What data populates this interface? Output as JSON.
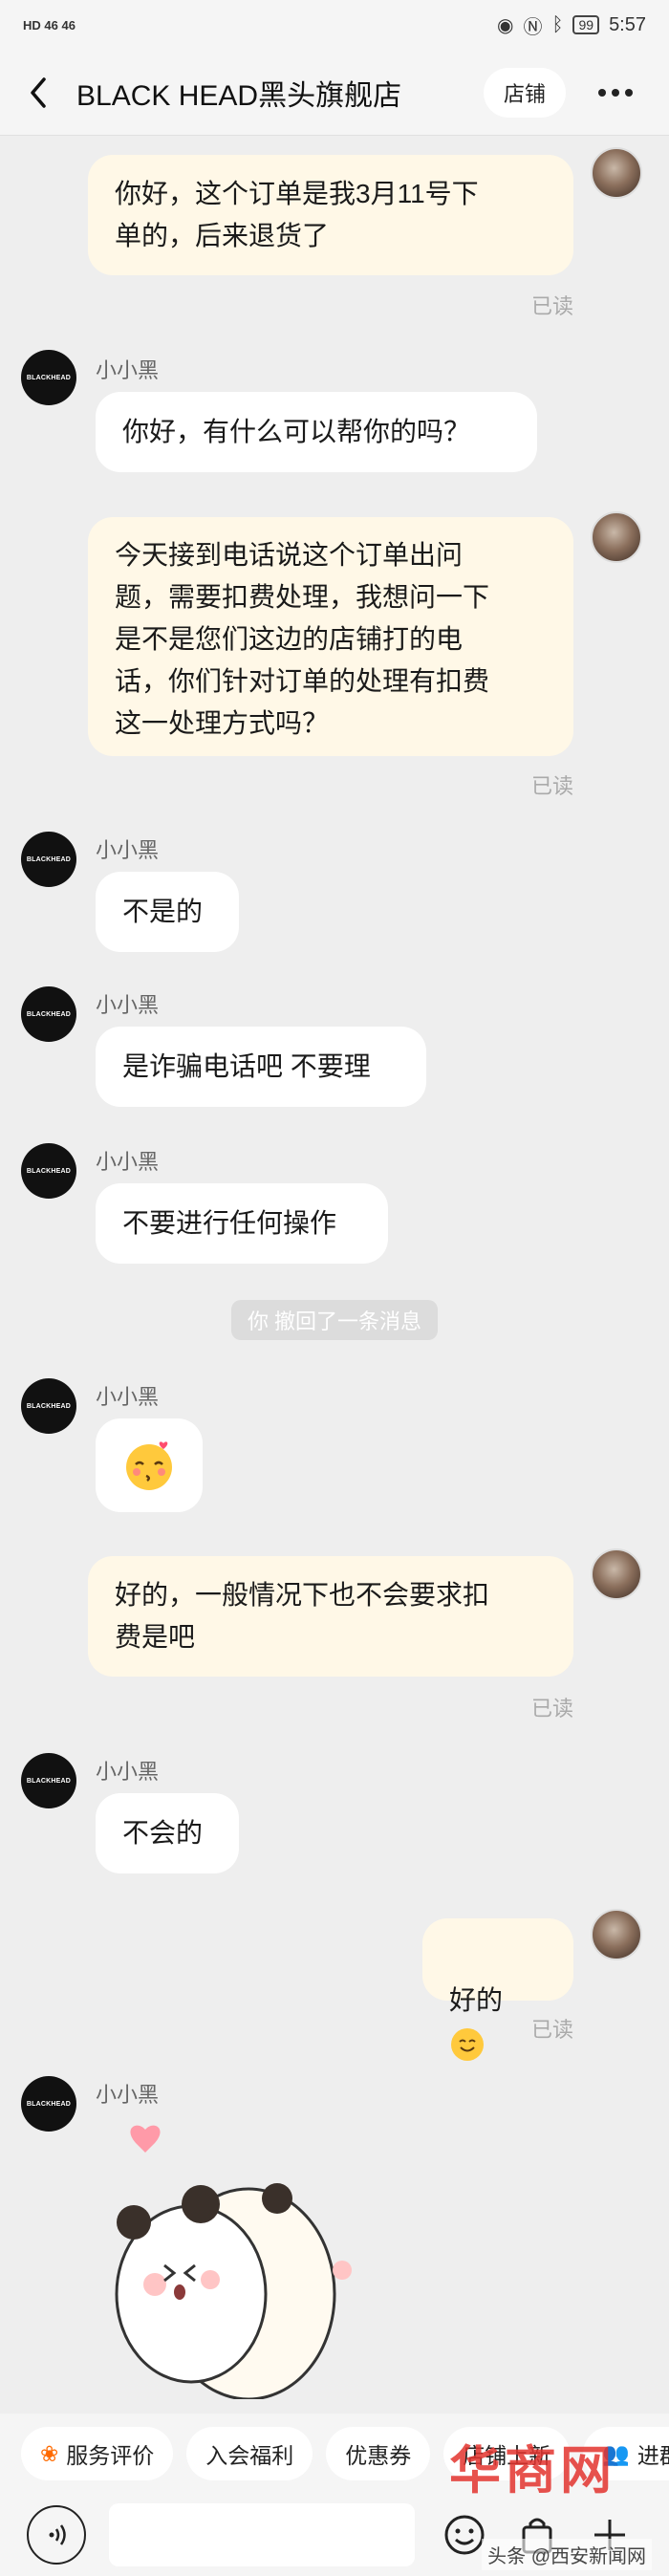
{
  "status_bar": {
    "left": "HD 46 46",
    "time": "5:57",
    "battery": "99"
  },
  "header": {
    "title": "BLACK HEAD黑头旗舰店",
    "shop_label": "店铺"
  },
  "shop_avatar_text": "BLACKHEAD",
  "messages": {
    "m1": "你好，这个订单是我3月11号下\n单的，后来退货了",
    "m1_read": "已读",
    "m2_sender": "小小黑",
    "m2": "你好，有什么可以帮你的吗？",
    "m3": "今天接到电话说这个订单出问\n题，需要扣费处理，我想问一下\n是不是您们这边的店铺打的电\n话，你们针对订单的处理有扣费\n这一处理方式吗？",
    "m3_read": "已读",
    "m4_sender": "小小黑",
    "m4": "不是的",
    "m5_sender": "小小黑",
    "m5": "是诈骗电话吧 不要理",
    "m6_sender": "小小黑",
    "m6": "不要进行任何操作",
    "recall": "你 撤回了一条消息",
    "m7_sender": "小小黑",
    "m8": "好的，一般情况下也不会要求扣\n费是吧",
    "m8_read": "已读",
    "m9_sender": "小小黑",
    "m9": "不会的",
    "m10": "好的",
    "m10_read": "已读",
    "m11_sender": "小小黑"
  },
  "quickbar": [
    "服务评价",
    "入会福利",
    "优惠券",
    "店铺上新",
    "进群"
  ],
  "watermark": {
    "logo": "華商網",
    "text": "头条 @西安新闻网"
  }
}
